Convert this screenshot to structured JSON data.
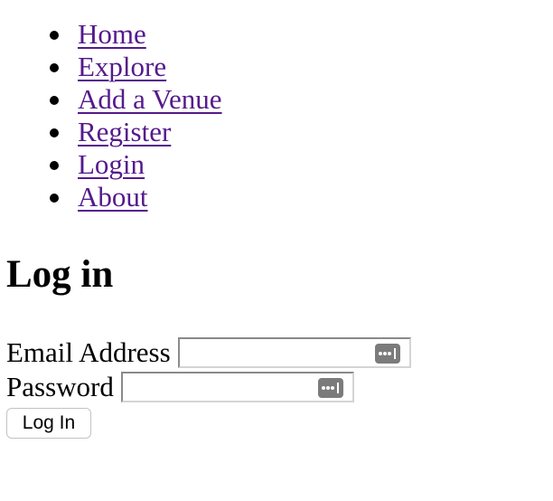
{
  "nav": {
    "items": [
      {
        "label": "Home"
      },
      {
        "label": "Explore"
      },
      {
        "label": "Add a Venue"
      },
      {
        "label": "Register"
      },
      {
        "label": "Login"
      },
      {
        "label": "About"
      }
    ]
  },
  "page": {
    "title": "Log in"
  },
  "form": {
    "email_label": "Email Address",
    "email_value": "",
    "password_label": "Password",
    "password_value": "",
    "autofill_icon": "password-key-icon",
    "submit_label": "Log In"
  },
  "colors": {
    "link_visited": "#551a8b",
    "text": "#000000",
    "icon": "#7b7b7b"
  }
}
